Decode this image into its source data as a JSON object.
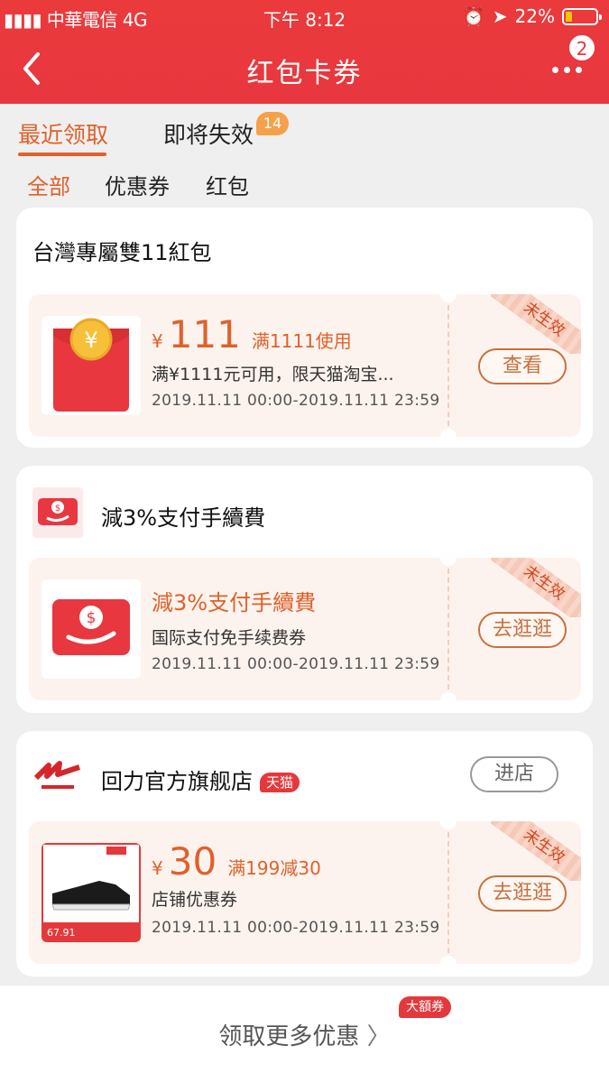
{
  "status_bar": {
    "carrier": "中華電信",
    "network": "4G",
    "time": "下午 8:12",
    "battery": "22%"
  },
  "navbar": {
    "title": "红包卡券",
    "notification_count": "2"
  },
  "tabs": [
    {
      "label": "最近领取",
      "active": true
    },
    {
      "label": "即将失效",
      "badge": "14"
    }
  ],
  "subtabs": [
    {
      "label": "全部",
      "active": true
    },
    {
      "label": "优惠券"
    },
    {
      "label": "红包"
    }
  ],
  "cards": [
    {
      "title": "台灣專屬雙11紅包",
      "coupon": {
        "currency": "¥",
        "amount": "111",
        "condition": "满1111使用",
        "desc": "满¥1111元可用，限天猫淘宝...",
        "date": "2019.11.11 00:00-2019.11.11 23:59",
        "stamp": "未生效",
        "action": "查看"
      }
    },
    {
      "title": "減3%支付手續費",
      "coupon": {
        "name": "減3%支付手續費",
        "desc": "国际支付免手续费券",
        "date": "2019.11.11 00:00-2019.11.11 23:59",
        "stamp": "未生效",
        "action": "去逛逛"
      }
    },
    {
      "title": "回力官方旗舰店",
      "tag": "天猫",
      "enter": "进店",
      "coupon": {
        "currency": "¥",
        "amount": "30",
        "condition": "满199减30",
        "desc": "店铺优惠券",
        "date": "2019.11.11 00:00-2019.11.11 23:59",
        "stamp": "未生效",
        "action": "去逛逛",
        "product_price": "67.91"
      }
    }
  ],
  "footer": {
    "text": "领取更多优惠",
    "badge": "大額券"
  },
  "colors": {
    "brand": "#e8373f",
    "accent": "#e0612a"
  }
}
